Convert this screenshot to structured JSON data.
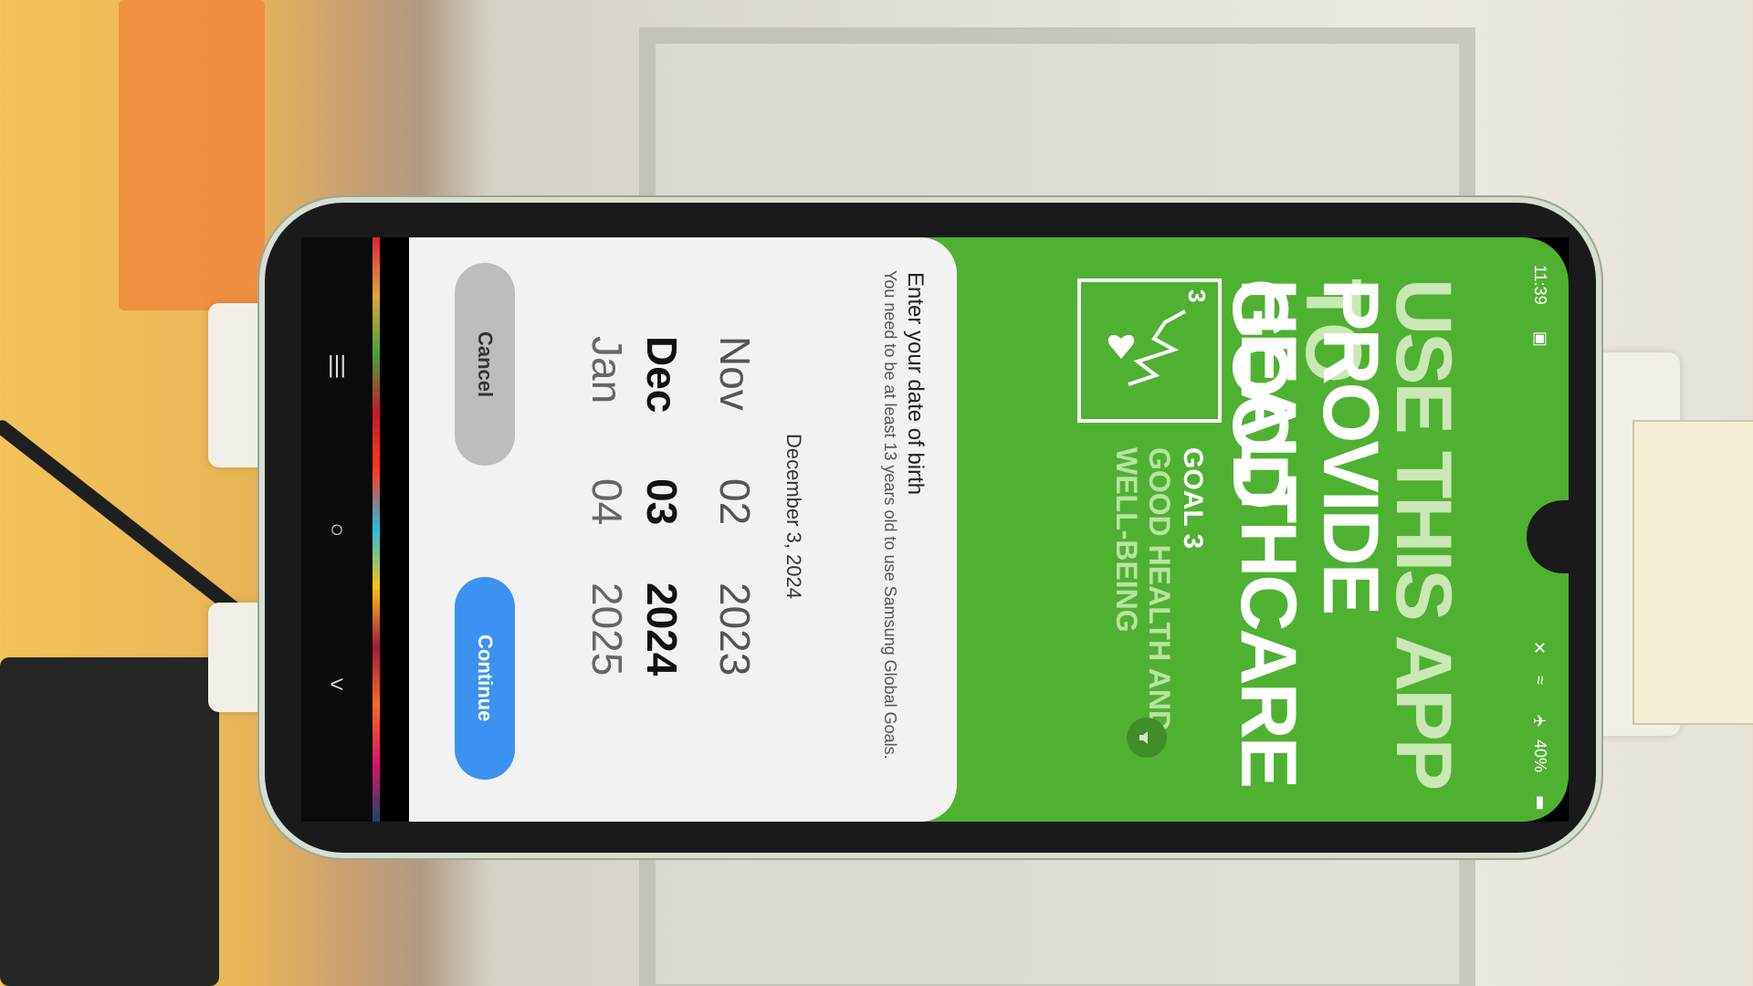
{
  "status_bar": {
    "time": "11:39",
    "battery": "40%",
    "icons": [
      "mute-icon",
      "wifi-icon",
      "airplane-icon",
      "battery-icon"
    ]
  },
  "banner": {
    "line1": "USE THIS APP TO",
    "line2": "PROVIDE GOOD",
    "line3": "HEALTHCARE",
    "goal_number": "3",
    "goal_title": "GOAL 3",
    "goal_subtitle": "GOOD HEALTH AND WELL-BEING",
    "colors": {
      "green": "#4fb132",
      "light_green": "#b9e39f"
    }
  },
  "dialog": {
    "title": "Enter your date of birth",
    "description": "You need to be at least 13 years old to use Samsung Global Goals.",
    "selected_date": "December 3, 2024",
    "picker": {
      "top": {
        "month": "Nov",
        "day": "02",
        "year": "2023"
      },
      "middle": {
        "month": "Dec",
        "day": "03",
        "year": "2024"
      },
      "bottom": {
        "month": "Jan",
        "day": "04",
        "year": "2025"
      }
    },
    "cancel_label": "Cancel",
    "continue_label": "Continue",
    "accent": "#3c92f0"
  },
  "navigation": {
    "recents": "|||",
    "home": "○",
    "back": "<"
  }
}
